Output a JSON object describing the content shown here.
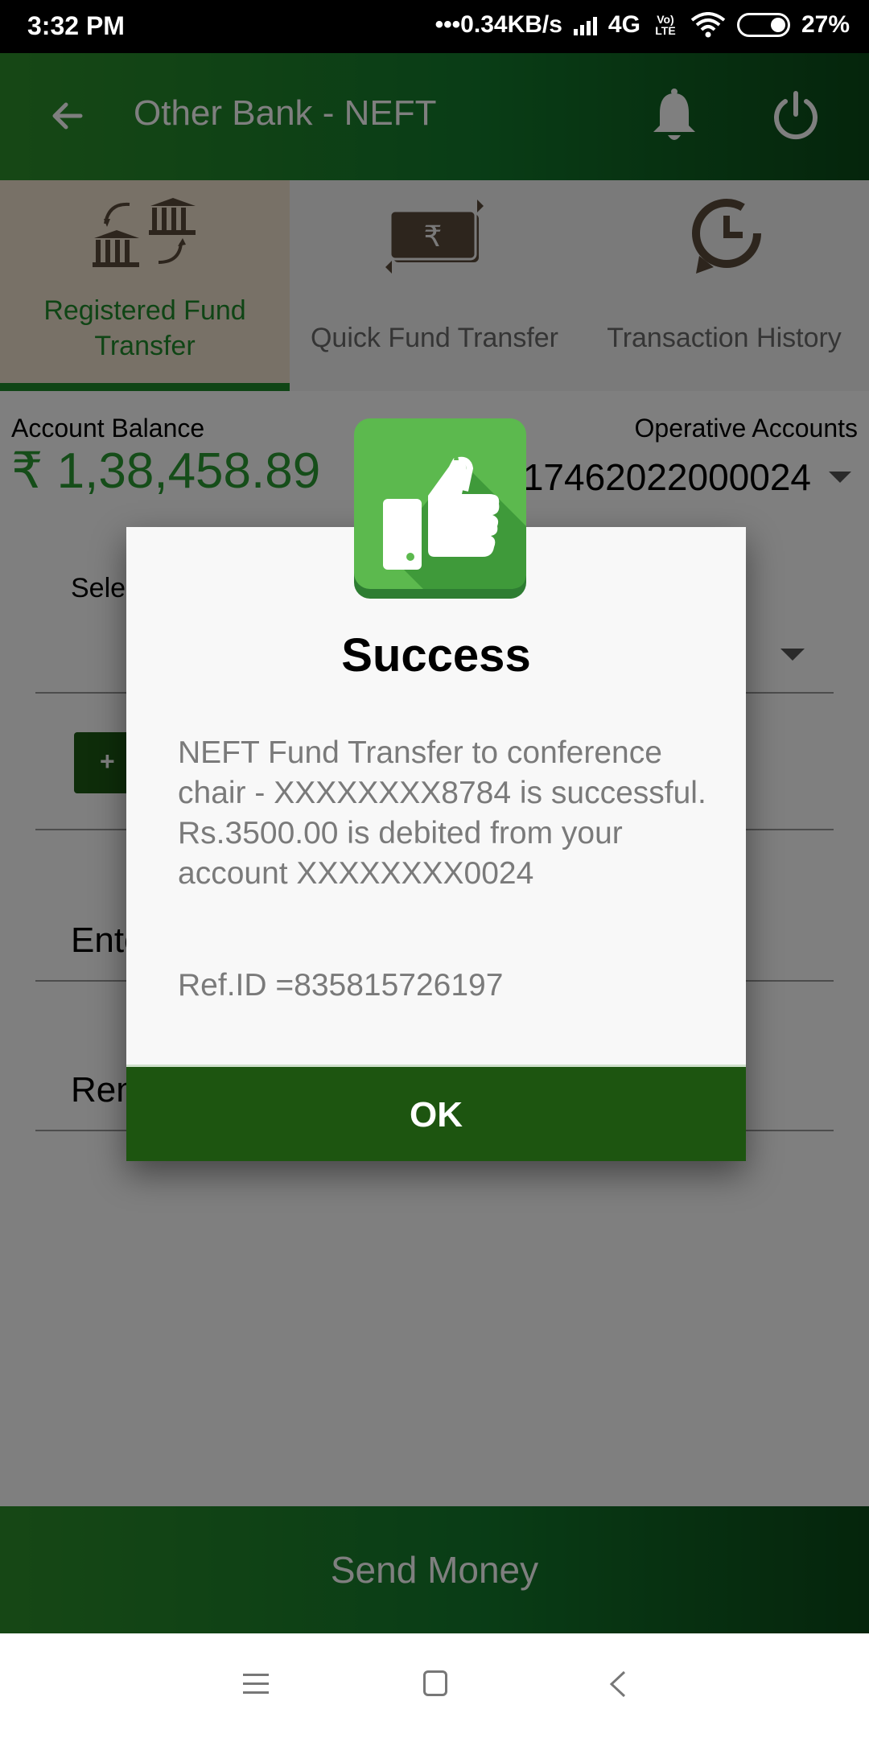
{
  "status_bar": {
    "time": "3:32 PM",
    "net_speed": "•••0.34KB/s",
    "network": "4G",
    "volte": "Vo) LTE",
    "battery": "27%"
  },
  "app_bar": {
    "title": "Other Bank - NEFT",
    "icons": [
      "back-arrow-icon",
      "bell-icon",
      "power-icon"
    ]
  },
  "tabs": [
    {
      "label": "Registered Fund Transfer",
      "icon": "bank-transfer-icon",
      "active": true
    },
    {
      "label": "Quick Fund Transfer",
      "icon": "rupee-note-icon",
      "active": false
    },
    {
      "label": "Transaction History",
      "icon": "history-clock-icon",
      "active": false
    }
  ],
  "account": {
    "balance_label": "Account Balance",
    "balance_value": "₹ 1,38,458.89",
    "operative_label": "Operative Accounts",
    "operative_value": "17462022000024"
  },
  "form": {
    "select_label": "Sele",
    "enter_text": "Ente",
    "remarks_text": "Ren"
  },
  "dialog": {
    "icon": "thumbs-up-icon",
    "title": "Success",
    "message": "NEFT Fund Transfer to conference chair - XXXXXXXX8784 is successful. Rs.3500.00 is debited from your account XXXXXXXX0024",
    "ref": "Ref.ID =835815726197",
    "ok_label": "OK"
  },
  "send_money_label": "Send Money",
  "colors": {
    "brand_green": "#137a2c",
    "accent_green": "#2b9a33",
    "dialog_button": "#1d5510",
    "active_tab_bg": "#f1e2cf"
  }
}
